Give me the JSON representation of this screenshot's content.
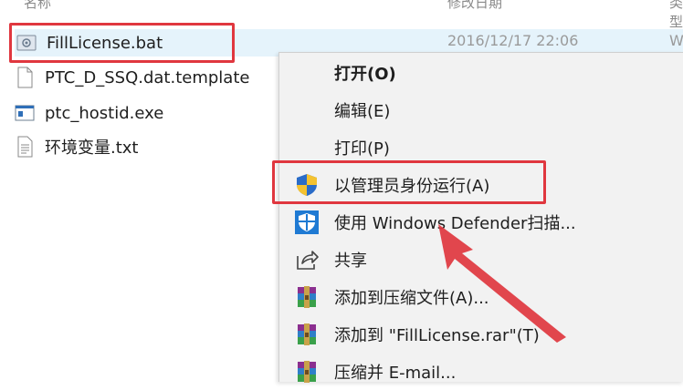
{
  "header": {
    "name_col": "名称",
    "date_col": "修改日期",
    "type_col": "类型"
  },
  "files": [
    {
      "name": "FillLicense.bat",
      "date": "2016/12/17 22:06",
      "type": "Win",
      "icon": "batch-file-icon",
      "selected": true
    },
    {
      "name": "PTC_D_SSQ.dat.template",
      "icon": "file-icon"
    },
    {
      "name": "ptc_hostid.exe",
      "icon": "exe-file-icon"
    },
    {
      "name": "环境变量.txt",
      "icon": "text-file-icon"
    }
  ],
  "menu": {
    "items": [
      {
        "label": "打开(O)",
        "icon": "",
        "bold": true
      },
      {
        "label": "编辑(E)",
        "icon": ""
      },
      {
        "label": "打印(P)",
        "icon": ""
      },
      {
        "label": "以管理员身份运行(A)",
        "icon": "uac-shield-icon",
        "highlight": true
      },
      {
        "label": "使用 Windows Defender扫描...",
        "icon": "defender-icon"
      },
      {
        "label": "共享",
        "icon": "share-icon"
      },
      {
        "label": "添加到压缩文件(A)...",
        "icon": "winrar-icon"
      },
      {
        "label": "添加到 \"FillLicense.rar\"(T)",
        "icon": "winrar-icon"
      },
      {
        "label": "压缩并 E-mail...",
        "icon": "winrar-icon"
      }
    ]
  },
  "colors": {
    "highlight_box": "#e0373f",
    "selection": "#e5f3fb",
    "menu_bg": "#f2f2f2",
    "arrow": "#e0373f"
  }
}
